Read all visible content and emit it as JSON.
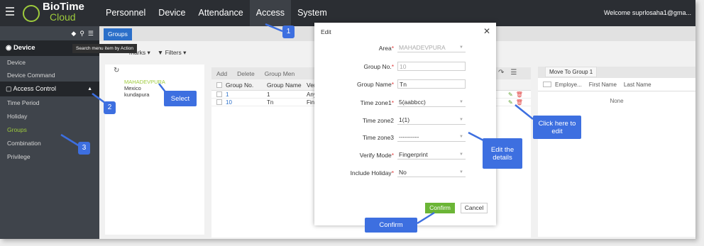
{
  "app": {
    "logo_main": "BioTime",
    "logo_sub": "Cloud",
    "welcome": "Welcome suprlosaha1@gma..."
  },
  "nav": [
    "Personnel",
    "Device",
    "Attendance",
    "Access",
    "System"
  ],
  "sidebar": {
    "device_title": "Device",
    "device_items": [
      "Device",
      "Device Command"
    ],
    "section_title": "Access Control",
    "section_items": [
      "Time Period",
      "Holiday",
      "Groups",
      "Combination",
      "Privilege"
    ]
  },
  "tab_label": "Groups",
  "tooltip": "Search menu item by Action",
  "filterbar": {
    "bookmarks": "marks",
    "filters": "Filters"
  },
  "tree": {
    "selected": "MAHADEVPURA",
    "items": [
      "Mexico",
      "kundapura"
    ]
  },
  "grid": {
    "toolbar": [
      "Add",
      "Delete",
      "Group Men"
    ],
    "headers": [
      "Group No.",
      "Group Name",
      "Verify"
    ],
    "rows": [
      {
        "no": "1",
        "name": "1",
        "verify": "Any"
      },
      {
        "no": "10",
        "name": "Tn",
        "verify": "Finge"
      }
    ]
  },
  "right_panel": {
    "tab": "Move To Group 1",
    "headers": [
      "Employe...",
      "First Name",
      "Last Name"
    ],
    "empty": "None"
  },
  "modal": {
    "title": "Edit",
    "fields": [
      {
        "label": "Area",
        "value": "MAHADEVPURA"
      },
      {
        "label": "Group No.",
        "value": "10"
      },
      {
        "label": "Group Name",
        "value": "Tn"
      },
      {
        "label": "Time zone1",
        "value": "5(aabbcc)"
      },
      {
        "label": "Time zone2",
        "value": "1(1)"
      },
      {
        "label": "Time zone3",
        "value": "----------"
      },
      {
        "label": "Verify Mode",
        "value": "Fingerprint"
      },
      {
        "label": "Include Holiday",
        "value": "No"
      }
    ],
    "confirm": "Confirm",
    "cancel": "Cancel"
  },
  "annotations": {
    "badge1": "1",
    "badge2": "2",
    "badge3": "3",
    "select": "Select",
    "click_edit_l1": "Click here to",
    "click_edit_l2": "edit",
    "edit_details_l1": "Edit the",
    "edit_details_l2": "details",
    "confirm": "Confirm"
  },
  "colors": {
    "accent_blue": "#2b6fc9",
    "brand_green": "#9ecb3c",
    "annotation_blue": "#3d6fe0"
  }
}
